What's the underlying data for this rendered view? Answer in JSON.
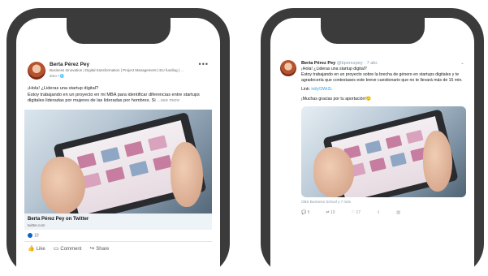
{
  "linkedin": {
    "author": "Berta Pérez Pey",
    "headline": "Business Innovation | Digital transformation | Project Management | EU funding | ...",
    "time": "3mo • 🌐",
    "more_menu": "•••",
    "post_line1": "¡Hola! ¿Lideras una startup digital?",
    "post_body": "Estoy trabajando en un proyecto en mi MBA para identificar diferencias entre startups digitales lideradas por mujeres de las lideradas por hombres. Si",
    "see_more": "...see more",
    "link_title": "Berta Pérez Pey on Twitter",
    "link_domain": "twitter.com",
    "reaction_count": "10",
    "actions": {
      "like": "Like",
      "comment": "Comment",
      "share": "Share"
    }
  },
  "twitter": {
    "author": "Berta Pérez Pey",
    "handle": "@bperezpey · 7 abr.",
    "caret": "⌄",
    "line1": "¡Hola! ¿Lideras una startup digital?",
    "line2": "Estoy trabajando en un proyecto sobre la brecha de género en startups digitales y te agradecería que contestases este breve cuestionario que no te llevará más de 15 min.",
    "link_label": "Link:",
    "link_url": "inl/y/2Wr2L",
    "thanks": "¡Muchas gracias por tu aportación!",
    "thanks_emoji": "🙂",
    "source": "OBS Business School y 7 más",
    "actions": {
      "reply": "5",
      "retweet": "10",
      "like": "17"
    }
  },
  "colors": {
    "phone_frame": "#3b3b3b",
    "linkedin_blue": "#0a66c2",
    "twitter_blue": "#1da1f2"
  }
}
